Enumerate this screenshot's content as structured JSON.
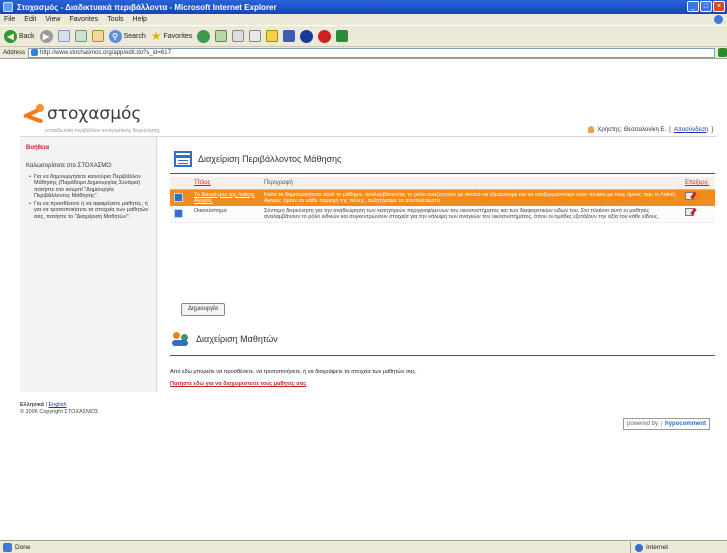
{
  "window": {
    "title": "Στοχασμός - Διαδικτυακά περιβάλλοντα - Microsoft Internet Explorer",
    "buttons": [
      "_",
      "□",
      "×"
    ]
  },
  "menu": [
    "File",
    "Edit",
    "View",
    "Favorites",
    "Tools",
    "Help"
  ],
  "toolbar": {
    "back_label": "Back",
    "search_label": "Search",
    "favorites_label": "Favorites"
  },
  "address": {
    "label": "Address",
    "url": "http://www.stochasmos.org/app/edit.do?s_id=617"
  },
  "site": {
    "logo_text": "στοχασμός",
    "tagline": "εκπαιδευτικό περιβάλλον συνεργατικής διερεύνησης"
  },
  "user": {
    "label": "Χρήστης: Θεσσαλονίκη Ε.",
    "logout": "Αποσύνδεση"
  },
  "sidebar": {
    "heading": "Βοήθεια",
    "intro": "Καλωσορίσατε στο ΣΤΟΧΑΣΜΟ:",
    "items": [
      "Για να δημιουργήσετε καινούριο Περιβάλλον Μάθησης (Παράθυρο Δημιουργίας Σενάρια) πατήστε στο κουμπί \"Δημιουργία Περιβάλλοντος Μάθησης\".",
      "Για να προσθέσετε ή να αφαιρέσετε μαθητές, ή για να τροποποιήσετε τα στοιχεία των μαθητών σας, πατήστε το \"Διαχείριση Μαθητών\"."
    ]
  },
  "main": {
    "env_section_title": "Διαχείριση Περιβάλλοντος Μάθησης",
    "table": {
      "headers": {
        "title": "Τίτλος",
        "description": "Περιγραφή",
        "edit": "Επεξεργ."
      },
      "rows": [
        {
          "title": "Το δίκτυό μου της Λαϊκής Αγοράς",
          "description": "Καλά τα δημιουργήσατε αυτό το μάθημα, αναλαμβάνοντας το ρόλο αναζητητών με σκοπό να εξετάσουμε και να επεξεργαστούμε έναν πίνακα με τους όρους που οι Λαϊκές Αγορές έχουν σε κάθε περιοχή της πόλης, συζητήσαμε τα αποτελέσματα"
        },
        {
          "title": "Οικοσύστημα",
          "description": "Σύντομη διερεύνηση για την αναθεώρηση των κατηγοριών περιγραφόμενων του οικοσυστήματος και των διαφορετικών ειδών του. Στο πλαίσιο αυτό οι μαθητές αναλαμβάνουν το ρόλο ειδικών και συγκεντρώνουν στοιχεία για την κάλυψη των αναγκών του οικοσυστήματος, όπου οι ομάδες εξετάζουν την αξία του κάθε είδους."
        }
      ]
    },
    "create_button": "Δημιουργία",
    "students_section_title": "Διαχείριση Μαθητών",
    "students_desc": "Από εδώ μπορείτε να προσθέσετε, να τροποποιήσετε, ή να διαγράψετε τα στοιχεία των μαθητών σας.",
    "students_link": "Πατήστε εδώ για να διαχειριστείτε τους μαθητές σας"
  },
  "footer": {
    "lang_current": "Ελληνικά",
    "lang_other": "English",
    "copyright": "© 2006 Copyright ΣΤΟΧΑΣΜΟΣ",
    "powered_label": "powered by",
    "powered_brand": "hypocomment"
  },
  "status": {
    "text": "Done",
    "zone": "Internet"
  },
  "colors": {
    "accent": "#c1272d",
    "selection": "#f28b1e",
    "brand_blue": "#2f6fc8"
  }
}
